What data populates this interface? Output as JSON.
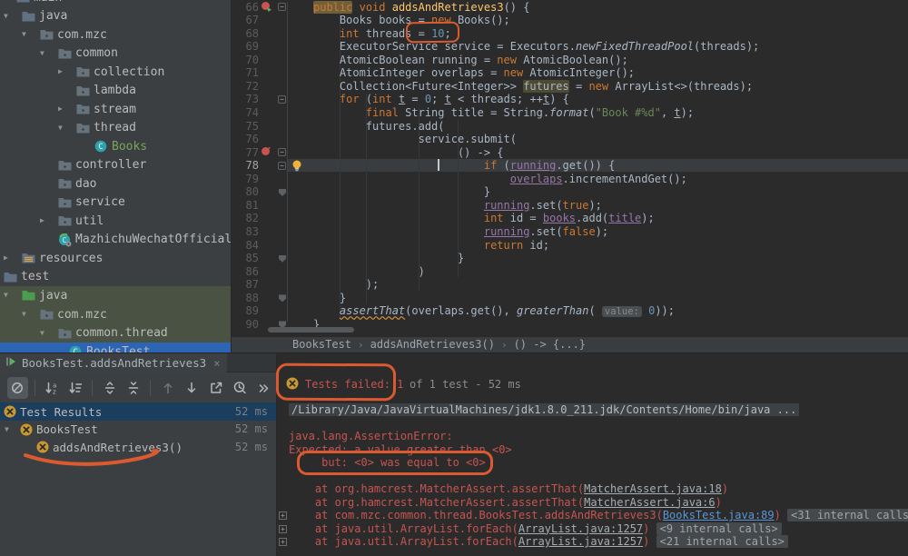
{
  "colors": {
    "panel_bg": "#3C3F41",
    "editor_bg": "#2B2B2B",
    "annotation": "#DC5A30",
    "keyword": "#CC7832",
    "number": "#6897BB",
    "string": "#6A8759",
    "field_purple": "#9876AA",
    "method_decl": "#FFC66D",
    "error_red": "#C75450",
    "selection_blue": "#1C3E5E",
    "tree_selection_blue": "#2D65B5",
    "test_row_tint": "#4A5244",
    "failed_icon_yellow": "#C9992F"
  },
  "project_tree": {
    "items": [
      {
        "label": "main",
        "level": 0.7,
        "arrow": null,
        "icon": "folder-icon",
        "partial": true
      },
      {
        "label": "java",
        "level": 1,
        "arrow": "expanded",
        "icon": "folder-icon"
      },
      {
        "label": "com.mzc",
        "level": 2,
        "arrow": "expanded",
        "icon": "package-icon"
      },
      {
        "label": "common",
        "level": 3,
        "arrow": "expanded",
        "icon": "package-icon"
      },
      {
        "label": "collection",
        "level": 4,
        "arrow": "collapsed",
        "icon": "package-icon"
      },
      {
        "label": "lambda",
        "level": 4,
        "arrow": null,
        "icon": "package-icon"
      },
      {
        "label": "stream",
        "level": 4,
        "arrow": "collapsed",
        "icon": "package-icon"
      },
      {
        "label": "thread",
        "level": 4,
        "arrow": "expanded",
        "icon": "package-icon"
      },
      {
        "label": "Books",
        "level": 5,
        "arrow": null,
        "icon": "class-icon",
        "label_color": "#7BA35A"
      },
      {
        "label": "controller",
        "level": 3,
        "arrow": null,
        "icon": "package-icon"
      },
      {
        "label": "dao",
        "level": 3,
        "arrow": null,
        "icon": "package-icon"
      },
      {
        "label": "service",
        "level": 3,
        "arrow": null,
        "icon": "package-icon"
      },
      {
        "label": "util",
        "level": 3,
        "arrow": "collapsed",
        "icon": "package-icon"
      },
      {
        "label": "MazhichuWechatOfficialAcco",
        "level": 3,
        "arrow": null,
        "icon": "class-gear-icon"
      },
      {
        "label": "resources",
        "level": 1,
        "arrow": "collapsed",
        "icon": "resources-folder-icon"
      },
      {
        "label": "test",
        "level": 0,
        "arrow": null,
        "icon": "folder-icon"
      },
      {
        "label": "java",
        "level": 1,
        "arrow": "expanded",
        "icon": "folder-green-icon",
        "row_bg": "#4A5244"
      },
      {
        "label": "com.mzc",
        "level": 2,
        "arrow": "expanded",
        "icon": "package-icon",
        "row_bg": "#4A5244"
      },
      {
        "label": "common.thread",
        "level": 3,
        "arrow": "expanded",
        "icon": "package-icon",
        "row_bg": "#4A5244"
      },
      {
        "label": "BooksTest",
        "level": 3.6,
        "arrow": null,
        "icon": "class-test-icon",
        "row_bg": "#2D65B5"
      }
    ]
  },
  "editor": {
    "lines": [
      {
        "num": 66,
        "fold": "start",
        "gutter_icons": [
          "failed-test-rerun-icon"
        ],
        "tokens": [
          {
            "t": "public",
            "c": "kw",
            "bg": 1
          },
          {
            "t": " "
          },
          {
            "t": "void",
            "c": "kw"
          },
          {
            "t": " "
          },
          {
            "t": "addsAndRetrieves3",
            "c": "mn"
          },
          {
            "t": "() {"
          }
        ]
      },
      {
        "num": 67,
        "tokens": [
          {
            "t": "    Books books = "
          },
          {
            "t": "new",
            "c": "kw"
          },
          {
            "t": " Books();"
          }
        ]
      },
      {
        "num": 68,
        "tokens": [
          {
            "t": "    "
          },
          {
            "t": "int",
            "c": "kw"
          },
          {
            "t": " threads = "
          },
          {
            "t": "10",
            "c": "n"
          },
          {
            "t": ";"
          }
        ]
      },
      {
        "num": 69,
        "tokens": [
          {
            "t": "    ExecutorService service = Executors."
          },
          {
            "t": "newFixedThreadPool",
            "i": 1
          },
          {
            "t": "(threads);"
          }
        ]
      },
      {
        "num": 70,
        "tokens": [
          {
            "t": "    AtomicBoolean running = "
          },
          {
            "t": "new",
            "c": "kw"
          },
          {
            "t": " AtomicBoolean();"
          }
        ]
      },
      {
        "num": 71,
        "tokens": [
          {
            "t": "    AtomicInteger overlaps = "
          },
          {
            "t": "new",
            "c": "kw"
          },
          {
            "t": " AtomicInteger();"
          }
        ]
      },
      {
        "num": 72,
        "tokens": [
          {
            "t": "    Collection<Future<Integer>> "
          },
          {
            "t": "futures",
            "bg": 2
          },
          {
            "t": " = "
          },
          {
            "t": "new",
            "c": "kw"
          },
          {
            "t": " ArrayList<>(threads);"
          }
        ]
      },
      {
        "num": 73,
        "fold": "start",
        "tokens": [
          {
            "t": "    "
          },
          {
            "t": "for",
            "c": "kw"
          },
          {
            "t": " ("
          },
          {
            "t": "int",
            "c": "kw"
          },
          {
            "t": " "
          },
          {
            "t": "t",
            "u": 1
          },
          {
            "t": " = "
          },
          {
            "t": "0",
            "c": "n"
          },
          {
            "t": "; "
          },
          {
            "t": "t",
            "u": 1
          },
          {
            "t": " < threads; ++"
          },
          {
            "t": "t",
            "u": 1
          },
          {
            "t": ") {"
          }
        ]
      },
      {
        "num": 74,
        "tokens": [
          {
            "t": "        "
          },
          {
            "t": "final",
            "c": "kw"
          },
          {
            "t": " String title = String."
          },
          {
            "t": "format",
            "i": 1
          },
          {
            "t": "("
          },
          {
            "t": "\"Book #%d\"",
            "c": "s"
          },
          {
            "t": ", "
          },
          {
            "t": "t",
            "u": 1
          },
          {
            "t": ");"
          }
        ]
      },
      {
        "num": 75,
        "tokens": [
          {
            "t": "        futures.add("
          }
        ]
      },
      {
        "num": 76,
        "tokens": [
          {
            "t": "                service.submit("
          }
        ]
      },
      {
        "num": 77,
        "fold": "start",
        "gutter_icons": [
          "failed-assertion-icon"
        ],
        "tokens": [
          {
            "t": "                      () -> {"
          }
        ]
      },
      {
        "num": 78,
        "fold": "start",
        "current": true,
        "gutter_icons": [
          "intention-bulb-icon"
        ],
        "tokens": [
          {
            "t": "                          "
          },
          {
            "t": "if",
            "c": "kw"
          },
          {
            "t": " ("
          },
          {
            "t": "running",
            "c": "f"
          },
          {
            "t": ".get()) {"
          }
        ]
      },
      {
        "num": 79,
        "tokens": [
          {
            "t": "                              "
          },
          {
            "t": "overlaps",
            "c": "f"
          },
          {
            "t": ".incrementAndGet();"
          }
        ]
      },
      {
        "num": 80,
        "fold": "end",
        "tokens": [
          {
            "t": "                          }"
          }
        ]
      },
      {
        "num": 81,
        "tokens": [
          {
            "t": "                          "
          },
          {
            "t": "running",
            "c": "f"
          },
          {
            "t": ".set("
          },
          {
            "t": "true",
            "c": "kw"
          },
          {
            "t": ");"
          }
        ]
      },
      {
        "num": 82,
        "tokens": [
          {
            "t": "                          "
          },
          {
            "t": "int",
            "c": "kw"
          },
          {
            "t": " id = "
          },
          {
            "t": "books",
            "c": "f"
          },
          {
            "t": ".add("
          },
          {
            "t": "title",
            "c": "f"
          },
          {
            "t": ");"
          }
        ]
      },
      {
        "num": 83,
        "tokens": [
          {
            "t": "                          "
          },
          {
            "t": "running",
            "c": "f"
          },
          {
            "t": ".set("
          },
          {
            "t": "false",
            "c": "kw"
          },
          {
            "t": ");"
          }
        ]
      },
      {
        "num": 84,
        "tokens": [
          {
            "t": "                          "
          },
          {
            "t": "return",
            "c": "kw"
          },
          {
            "t": " id;"
          }
        ]
      },
      {
        "num": 85,
        "fold": "end",
        "tokens": [
          {
            "t": "                      }"
          }
        ]
      },
      {
        "num": 86,
        "tokens": [
          {
            "t": "                )"
          }
        ]
      },
      {
        "num": 87,
        "tokens": [
          {
            "t": "        );"
          }
        ]
      },
      {
        "num": 88,
        "fold": "end",
        "tokens": [
          {
            "t": "    }"
          }
        ]
      },
      {
        "num": 89,
        "tokens": [
          {
            "t": "    "
          },
          {
            "t": "assertThat",
            "i": 1,
            "w": 1
          },
          {
            "t": "(overlaps.get(), "
          },
          {
            "t": "greaterThan",
            "i": 1
          },
          {
            "t": "( "
          },
          {
            "t": "value:",
            "c": "hint"
          },
          {
            "t": " "
          },
          {
            "t": "0",
            "c": "n"
          },
          {
            "t": "));"
          }
        ]
      },
      {
        "num": 90,
        "fold": "end",
        "tokens": [
          {
            "t": "}"
          }
        ]
      }
    ],
    "breadcrumb": {
      "items": [
        "BooksTest",
        "addsAndRetrieves3()",
        "() -> {...}"
      ],
      "separator": "›"
    }
  },
  "test_panel": {
    "tab": {
      "icon": "run-tab-icon",
      "label": "BooksTest.addsAndRetrieves3",
      "close": "×"
    },
    "toolbar": {
      "icons": [
        {
          "name": "hide-passed-icon",
          "group": 1,
          "state": "selected"
        },
        {
          "name": "sort-alphabetically-icon",
          "group": 2
        },
        {
          "name": "sort-by-duration-icon",
          "group": 2
        },
        {
          "name": "expand-all-icon",
          "group": 3
        },
        {
          "name": "collapse-all-icon",
          "group": 3
        },
        {
          "name": "previous-failed-test-icon",
          "group": 4,
          "state": "disabled"
        },
        {
          "name": "next-failed-test-icon",
          "group": 4
        },
        {
          "name": "export-test-results-icon",
          "group": 4
        },
        {
          "name": "test-history-icon",
          "group": 4
        },
        {
          "name": "more-options-icon",
          "group": 4
        }
      ]
    },
    "tree": {
      "rows": [
        {
          "label": "Test Results",
          "time": "52 ms",
          "level": 0,
          "arrow": null,
          "icon": "test-failed-icon",
          "selected": true
        },
        {
          "label": "BooksTest",
          "time": "52 ms",
          "level": 1,
          "arrow": "expanded",
          "icon": "test-failed-icon"
        },
        {
          "label": "addsAndRetrieves3()",
          "time": "52 ms",
          "level": 2,
          "arrow": null,
          "icon": "test-failed-icon"
        }
      ]
    }
  },
  "console": {
    "header": {
      "icon": "test-failed-icon",
      "failed_text": "Tests failed: 1",
      "rest_text": "of 1 test - 52 ms"
    },
    "lines": [
      {
        "strip": true,
        "tokens": [
          {
            "t": "/Library/Java/JavaVirtualMachines/jdk1.8.0_211.jdk/Contents/Home/bin/java ...",
            "c": "g"
          }
        ]
      },
      {
        "blank": true
      },
      {
        "tokens": [
          {
            "t": "java.lang.AssertionError:",
            "c": "r"
          }
        ]
      },
      {
        "tokens": [
          {
            "t": "Expected: a value greater than <0>",
            "c": "r"
          }
        ]
      },
      {
        "tokens": [
          {
            "t": "     but: <0> was equal to <0>",
            "c": "r"
          }
        ]
      },
      {
        "blank": true
      },
      {
        "tokens": [
          {
            "t": "    at org.hamcrest.MatcherAssert.assertThat(",
            "c": "r"
          },
          {
            "t": "MatcherAssert.java:18",
            "c": "lg"
          },
          {
            "t": ")",
            "c": "r"
          }
        ]
      },
      {
        "tokens": [
          {
            "t": "    at org.hamcrest.MatcherAssert.assertThat(",
            "c": "r"
          },
          {
            "t": "MatcherAssert.java:6",
            "c": "lg"
          },
          {
            "t": ")",
            "c": "r"
          }
        ]
      },
      {
        "expand_box": true,
        "tokens": [
          {
            "t": "    at com.mzc.common.thread.BooksTest.addsAndRetrieves3(",
            "c": "r"
          },
          {
            "t": "BooksTest.java:89",
            "c": "lb"
          },
          {
            "t": ")",
            "c": "r"
          },
          {
            "t": " "
          },
          {
            "t": "<31 internal calls>",
            "c": "chip"
          }
        ]
      },
      {
        "expand_box": true,
        "tokens": [
          {
            "t": "    at java.util.ArrayList.forEach(",
            "c": "r"
          },
          {
            "t": "ArrayList.java:1257",
            "c": "lg"
          },
          {
            "t": ")",
            "c": "r"
          },
          {
            "t": " "
          },
          {
            "t": "<9 internal calls>",
            "c": "chip"
          }
        ]
      },
      {
        "expand_box": true,
        "tokens": [
          {
            "t": "    at java.util.ArrayList.forEach(",
            "c": "r"
          },
          {
            "t": "ArrayList.java:1257",
            "c": "lg"
          },
          {
            "t": ")",
            "c": "r"
          },
          {
            "t": " "
          },
          {
            "t": "<21 internal calls>",
            "c": "chip"
          }
        ]
      }
    ]
  },
  "annotations": {
    "color": "#DC5A30",
    "items": [
      "box-around-threads-value",
      "box-around-tests-failed",
      "box-around-but-equal",
      "underline-failed-test-name"
    ]
  }
}
